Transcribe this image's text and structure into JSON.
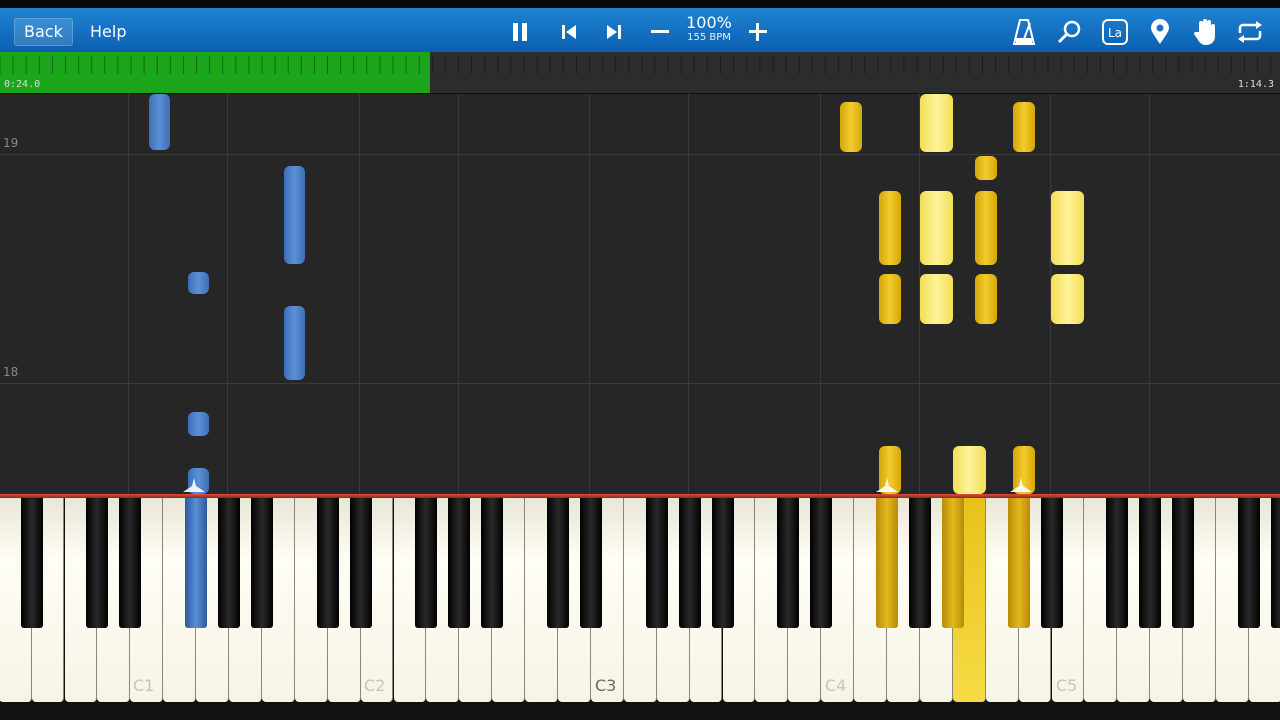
{
  "toolbar": {
    "back_label": "Back",
    "help_label": "Help",
    "zoom_percent": "100%",
    "bpm": "155 BPM",
    "icons": [
      "pause-icon",
      "skip-back-icon",
      "skip-forward-icon",
      "minus-icon",
      "plus-icon",
      "metronome-icon",
      "search-icon",
      "label-icon",
      "location-pin-icon",
      "hand-icon",
      "loop-icon"
    ],
    "label_icon_text": "La"
  },
  "progress": {
    "current_time": "0:24.0",
    "total_time": "1:14.3",
    "fraction": 0.336
  },
  "roll": {
    "measures": [
      "19",
      "18"
    ]
  },
  "keyboard": {
    "octave_labels": [
      "C1",
      "C2",
      "C3",
      "C4",
      "C5"
    ],
    "colors": {
      "left_hand": "#4f82c8",
      "right_hand": "#e8b91c",
      "right_hand_light": "#fbe97a"
    }
  }
}
